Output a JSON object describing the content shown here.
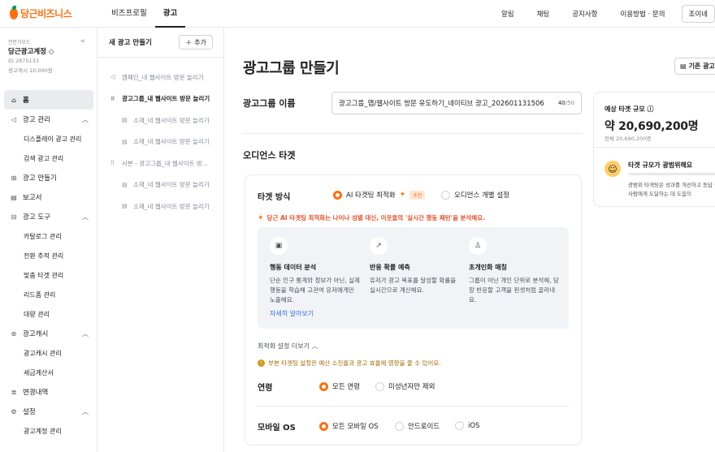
{
  "app": {
    "logo_text": "당근비즈니스",
    "nav": [
      {
        "label": "비즈프로필"
      },
      {
        "label": "광고",
        "active": true
      }
    ],
    "right_links": [
      "알림",
      "채팅",
      "공지사항",
      "이용방법 · 문의"
    ],
    "join_label": "조이네"
  },
  "account": {
    "type_label": "전문가모드",
    "name": "당근광고계정 ◇",
    "id": "ID 2875133",
    "cash": "광고캐시 10,000원"
  },
  "sidebar": {
    "items": [
      {
        "label": "홈",
        "icon": "home-icon",
        "active": true
      },
      {
        "label": "광고 관리",
        "icon": "megaphone-icon",
        "chevron": "up"
      },
      {
        "label": "디스플레이 광고 관리",
        "sub": true
      },
      {
        "label": "검색 광고 관리",
        "sub": true
      },
      {
        "label": "광고 만들기",
        "icon": "plus-square-icon"
      },
      {
        "label": "보고서",
        "icon": "report-icon"
      },
      {
        "label": "광고 도구",
        "icon": "toolbox-icon",
        "chevron": "up"
      },
      {
        "label": "카탈로그 관리",
        "sub": true
      },
      {
        "label": "전환 추적 관리",
        "sub": true
      },
      {
        "label": "맞춤 타겟 관리",
        "sub": true
      },
      {
        "label": "리드폼 관리",
        "sub": true
      },
      {
        "label": "대량 관리",
        "sub": true
      },
      {
        "label": "광고캐시",
        "icon": "coin-icon",
        "chevron": "up"
      },
      {
        "label": "광고캐시 관리",
        "sub": true
      },
      {
        "label": "세금계산서",
        "sub": true
      },
      {
        "label": "변경내역",
        "icon": "history-icon"
      },
      {
        "label": "설정",
        "icon": "gear-icon",
        "chevron": "up"
      },
      {
        "label": "광고계정 관리",
        "sub": true
      }
    ]
  },
  "tree_panel": {
    "title": "새 광고 만들기",
    "add_label": "추가",
    "items": [
      {
        "label": "캠페인_내 웹사이트 방문 늘리기",
        "level": 1,
        "icon": "megaphone-icon"
      },
      {
        "label": "광고그룹_내 웹사이트 방문 늘리기",
        "level": 1,
        "icon": "grid-icon",
        "active": true
      },
      {
        "label": "소재_내 웹사이트 방문 늘리기",
        "level": 2,
        "icon": "doc-icon"
      },
      {
        "label": "소재_내 웹사이트 방문 늘리기",
        "level": 2,
        "icon": "doc-icon"
      },
      {
        "label": "사본 - 광고그룹_내 웹사이트 방...",
        "level": 1,
        "icon": "grid-icon"
      },
      {
        "label": "소재_내 웹사이트 방문 늘리기",
        "level": 2,
        "icon": "doc-icon"
      },
      {
        "label": "소재_내 웹사이트 방문 늘리기",
        "level": 2,
        "icon": "doc-icon"
      }
    ]
  },
  "main": {
    "title": "광고그룹 만들기",
    "ref_button": "기존 광고",
    "group_name_label": "광고그룹 이름",
    "group_name_value": "광고그룹_앱/웹사이트 방문 유도하기_네이티브 광고_202601131506",
    "group_name_count": "40",
    "group_name_max": "/50",
    "audience_title": "오디언스 타겟",
    "target_method_label": "타겟 방식",
    "target_options": [
      {
        "label": "AI 타겟팅 최적화",
        "selected": true,
        "badge": "추천"
      },
      {
        "label": "오디언스 개별 설정",
        "selected": false
      }
    ],
    "ai_note": "당근 AI 타겟팅 최적화는 나이나 성별 대신, 이웃들의 '실시간 행동 패턴'을 분석해요.",
    "features": [
      {
        "icon": "chat-icon",
        "title": "행동 데이터 분석",
        "desc": "단순 인구 통계와 정보가 아닌, 실제 행동을 학습해 고관여 유저에게만 노출해요."
      },
      {
        "icon": "trend-icon",
        "title": "반응 확률 예측",
        "desc": "유저가 광고 목표를 달성할 확률을 실시간으로 계산해요."
      },
      {
        "icon": "person-icon",
        "title": "초개인화 매칭",
        "desc": "그룹이 아닌 개인 단위로 분석해, 당장 반응할 고객을 핀셋처럼 골라내요."
      }
    ],
    "learn_more": "자세히 알아보기",
    "opt_toggle": "최적화 설정 더보기 ︿",
    "warning": "부분 타겟팅 설정은 예산 소진율과 광고 효율에 영향을 줄 수 있어요.",
    "age_label": "연령",
    "age_options": [
      {
        "label": "모든 연령",
        "selected": true
      },
      {
        "label": "미성년자만 제외",
        "selected": false
      }
    ],
    "os_label": "모바일 OS",
    "os_options": [
      {
        "label": "모든 모바일 OS",
        "selected": true
      },
      {
        "label": "안드로이드",
        "selected": false
      },
      {
        "label": "iOS",
        "selected": false
      }
    ]
  },
  "side_card": {
    "title": "예상 타겟 규모 ⓘ",
    "value": "약 20,690,200명",
    "total": "전체 20,690,200명",
    "status": "타겟 규모가 광범위해요",
    "fill": 0.08,
    "desc": "광범위 타게팅은 성과를 개선하고 동답 큰 더 많은 사람에게 도달하는 데 도움이"
  },
  "colors": {
    "accent": "#ff6f0f",
    "green": "#00a05b",
    "link": "#2f6fe4"
  }
}
